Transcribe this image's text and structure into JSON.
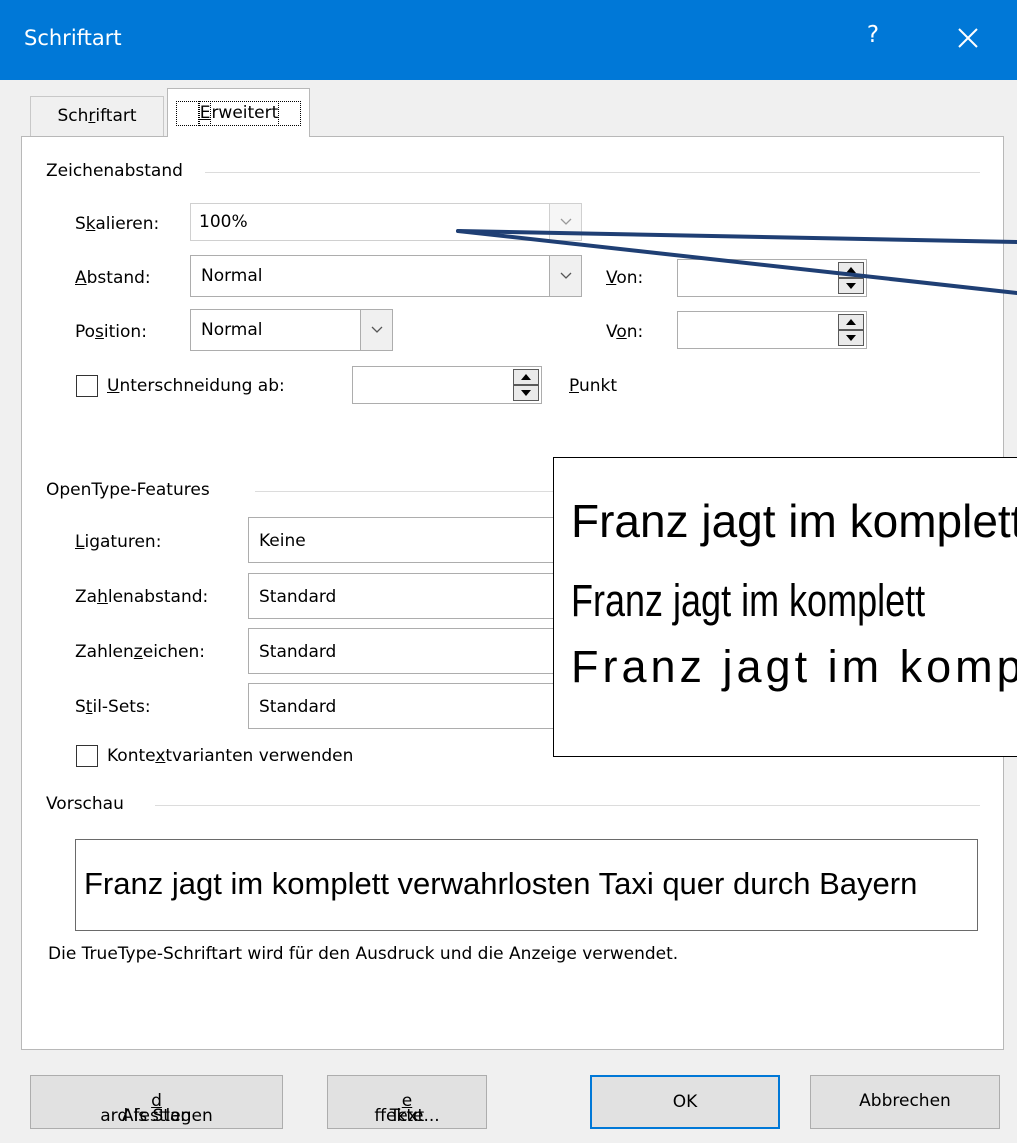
{
  "window": {
    "title": "Schriftart",
    "help": "?"
  },
  "tabs": [
    {
      "pre": "Sch",
      "key": "r",
      "post": "iftart"
    },
    {
      "pre": "",
      "key": "E",
      "post": "rweitert"
    }
  ],
  "spacing": {
    "group": "Zeichenabstand",
    "scale": {
      "pre": "S",
      "key": "k",
      "post": "alieren:",
      "value": "100%"
    },
    "spacing": {
      "pre": "",
      "key": "A",
      "post": "bstand:",
      "value": "Normal"
    },
    "spacing_by": {
      "pre": "",
      "key": "V",
      "post": "on:",
      "value": ""
    },
    "position": {
      "pre": "Po",
      "key": "s",
      "post": "ition:",
      "value": "Normal"
    },
    "position_by": {
      "pre": "V",
      "key": "o",
      "post": "n:",
      "value": ""
    },
    "kerning": {
      "pre": "",
      "key": "U",
      "post": "nterschneidung ab:",
      "value": "",
      "checked": false
    },
    "kerning_unit": {
      "pre": "",
      "key": "P",
      "post": "unkt"
    }
  },
  "opentype": {
    "group": "OpenType-Features",
    "ligatures": {
      "pre": "",
      "key": "L",
      "post": "igaturen:",
      "value": "Keine"
    },
    "number_spacing": {
      "pre": "Za",
      "key": "h",
      "post": "lenabstand:",
      "value": "Standard"
    },
    "number_forms": {
      "pre": "Zahlen",
      "key": "z",
      "post": "eichen:",
      "value": "Standard"
    },
    "stylistic_sets": {
      "pre": "S",
      "key": "t",
      "post": "il-Sets:",
      "value": "Standard"
    },
    "contextual": {
      "pre": "Konte",
      "key": "x",
      "post": "tvarianten verwenden",
      "checked": false
    }
  },
  "preview": {
    "group": "Vorschau",
    "sample": "Franz jagt im komplett verwahrlosten Taxi quer durch Bayern",
    "note": "Die TrueType-Schriftart wird für den Ausdruck und die Anzeige verwendet."
  },
  "callout": {
    "lines": [
      "Franz jagt im komplett",
      "Franz jagt im komplett",
      "Franz jagt im komplett"
    ]
  },
  "buttons": {
    "set_default": {
      "pre": "Als Stan",
      "key": "d",
      "post": "ard festlegen"
    },
    "text_effects": {
      "pre": "Text",
      "key": "e",
      "post": "ffekte..."
    },
    "ok": "OK",
    "cancel": "Abbrechen"
  },
  "colors": {
    "titlebar": "#0078d7",
    "callout_arrow": "#1f3f74"
  }
}
